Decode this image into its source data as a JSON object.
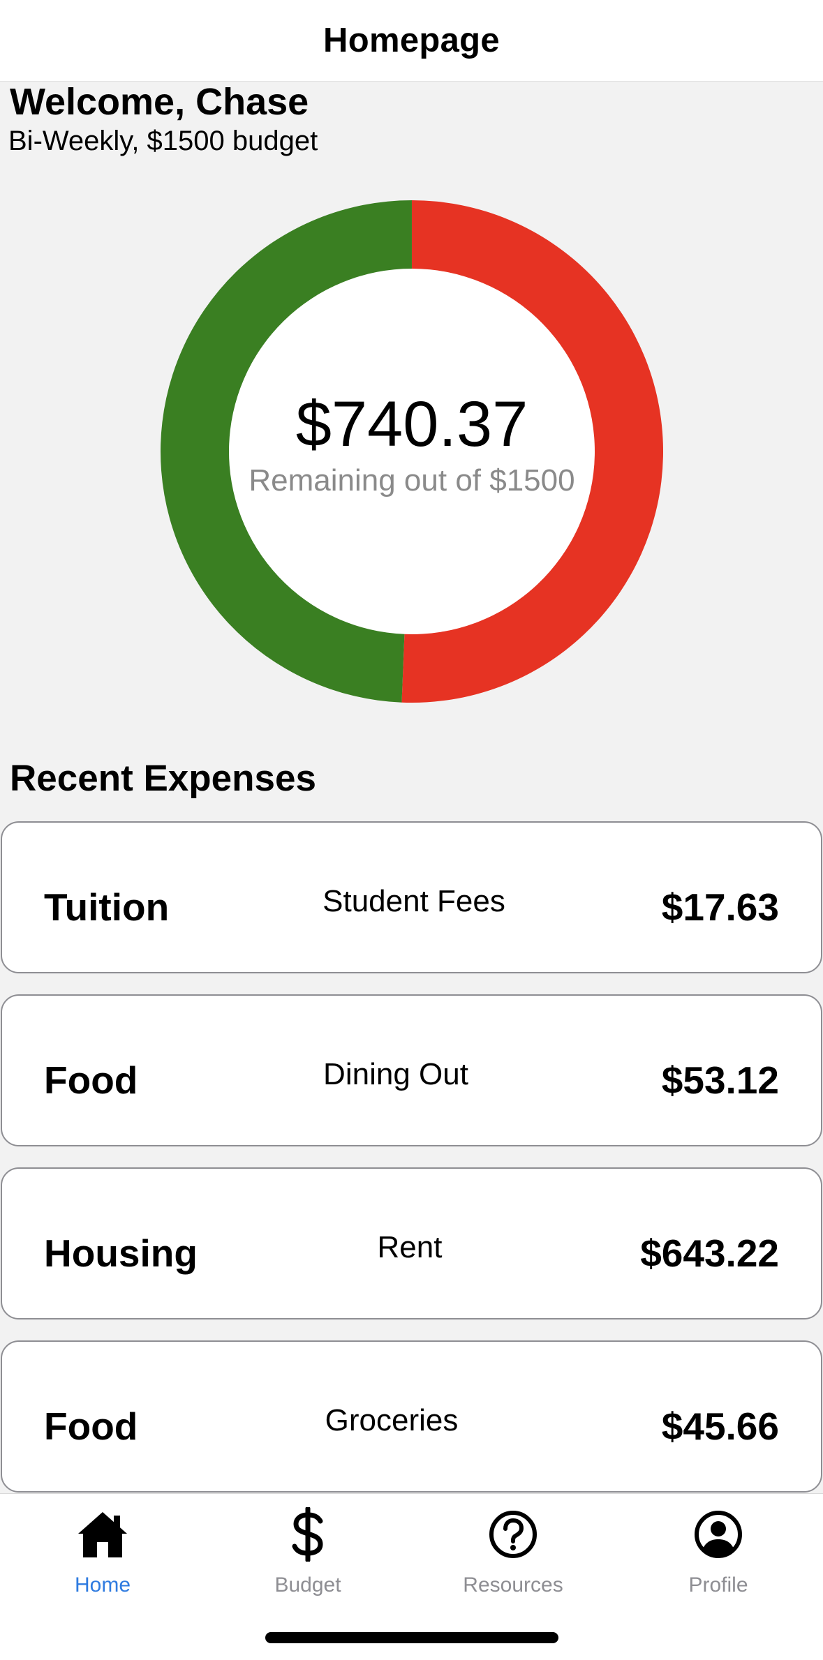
{
  "header": {
    "title": "Homepage"
  },
  "welcome": {
    "greeting": "Welcome, Chase",
    "budget_line": "Bi-Weekly, $1500 budget"
  },
  "budget_ring": {
    "remaining_amount": "$740.37",
    "caption": "Remaining out of $1500",
    "total": 1500,
    "remaining": 740.37,
    "spent_color": "#e63323",
    "remaining_color": "#3a7f22"
  },
  "recent_expenses": {
    "title": "Recent Expenses",
    "items": [
      {
        "category": "Tuition",
        "description": "Student Fees",
        "amount": "$17.63"
      },
      {
        "category": "Food",
        "description": "Dining Out",
        "amount": "$53.12"
      },
      {
        "category": "Housing",
        "description": "Rent",
        "amount": "$643.22"
      },
      {
        "category": "Food",
        "description": "Groceries",
        "amount": "$45.66"
      }
    ]
  },
  "tab_bar": {
    "active_color": "#2f7be0",
    "tabs": [
      {
        "label": "Home",
        "icon": "home-icon",
        "active": true
      },
      {
        "label": "Budget",
        "icon": "dollar-icon",
        "active": false
      },
      {
        "label": "Resources",
        "icon": "question-circle-icon",
        "active": false
      },
      {
        "label": "Profile",
        "icon": "user-circle-icon",
        "active": false
      }
    ]
  }
}
